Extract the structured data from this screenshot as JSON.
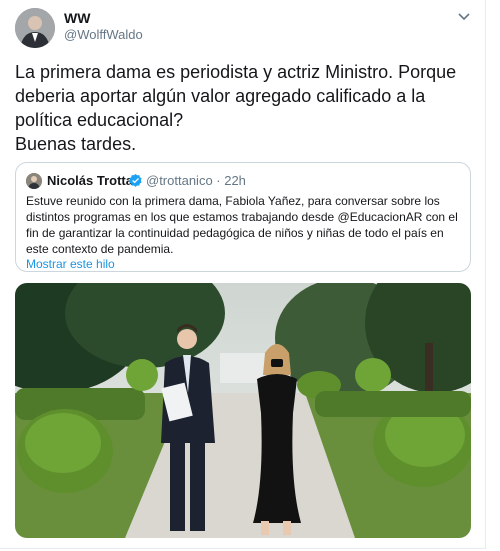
{
  "author": {
    "name": "WW",
    "handle": "@WolffWaldo"
  },
  "tweet": {
    "lines": [
      "La primera dama es periodista y actriz Ministro. Porque deberia aportar algún valor agregado calificado a la política educacional?",
      "Buenas tardes."
    ]
  },
  "quoted": {
    "name": "Nicolás Trotta",
    "handle_time": "@trottanico · 22h",
    "text": "Estuve reunido con la primera dama, Fabiola Yañez, para conversar sobre los distintos programas en los que estamos trabajando desde @EducacionAR con el fin de garantizar la continuidad pedagógica de niños y niñas de todo el país en este contexto de pandemia.",
    "show_thread": "Mostrar este hilo"
  },
  "colors": {
    "link": "#1b95e0",
    "muted": "#657786",
    "border": "#ccd6dd"
  },
  "icons": [
    "chevron-down-icon",
    "verified-badge-icon"
  ]
}
